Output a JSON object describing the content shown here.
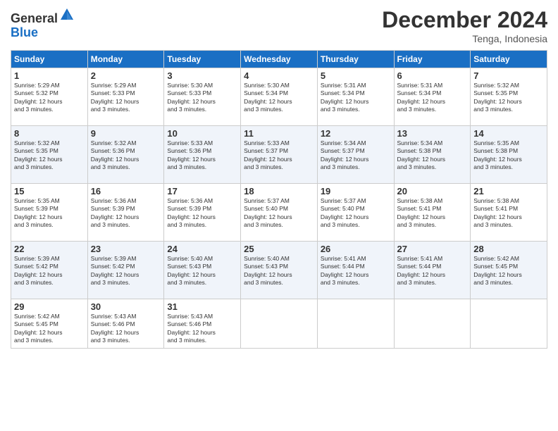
{
  "header": {
    "logo_general": "General",
    "logo_blue": "Blue",
    "month": "December 2024",
    "location": "Tenga, Indonesia"
  },
  "days_of_week": [
    "Sunday",
    "Monday",
    "Tuesday",
    "Wednesday",
    "Thursday",
    "Friday",
    "Saturday"
  ],
  "weeks": [
    [
      {
        "day": "1",
        "sunrise": "5:29 AM",
        "sunset": "5:32 PM",
        "daylight": "12 hours and 3 minutes."
      },
      {
        "day": "2",
        "sunrise": "5:29 AM",
        "sunset": "5:33 PM",
        "daylight": "12 hours and 3 minutes."
      },
      {
        "day": "3",
        "sunrise": "5:30 AM",
        "sunset": "5:33 PM",
        "daylight": "12 hours and 3 minutes."
      },
      {
        "day": "4",
        "sunrise": "5:30 AM",
        "sunset": "5:34 PM",
        "daylight": "12 hours and 3 minutes."
      },
      {
        "day": "5",
        "sunrise": "5:31 AM",
        "sunset": "5:34 PM",
        "daylight": "12 hours and 3 minutes."
      },
      {
        "day": "6",
        "sunrise": "5:31 AM",
        "sunset": "5:34 PM",
        "daylight": "12 hours and 3 minutes."
      },
      {
        "day": "7",
        "sunrise": "5:32 AM",
        "sunset": "5:35 PM",
        "daylight": "12 hours and 3 minutes."
      }
    ],
    [
      {
        "day": "8",
        "sunrise": "5:32 AM",
        "sunset": "5:35 PM",
        "daylight": "12 hours and 3 minutes."
      },
      {
        "day": "9",
        "sunrise": "5:32 AM",
        "sunset": "5:36 PM",
        "daylight": "12 hours and 3 minutes."
      },
      {
        "day": "10",
        "sunrise": "5:33 AM",
        "sunset": "5:36 PM",
        "daylight": "12 hours and 3 minutes."
      },
      {
        "day": "11",
        "sunrise": "5:33 AM",
        "sunset": "5:37 PM",
        "daylight": "12 hours and 3 minutes."
      },
      {
        "day": "12",
        "sunrise": "5:34 AM",
        "sunset": "5:37 PM",
        "daylight": "12 hours and 3 minutes."
      },
      {
        "day": "13",
        "sunrise": "5:34 AM",
        "sunset": "5:38 PM",
        "daylight": "12 hours and 3 minutes."
      },
      {
        "day": "14",
        "sunrise": "5:35 AM",
        "sunset": "5:38 PM",
        "daylight": "12 hours and 3 minutes."
      }
    ],
    [
      {
        "day": "15",
        "sunrise": "5:35 AM",
        "sunset": "5:39 PM",
        "daylight": "12 hours and 3 minutes."
      },
      {
        "day": "16",
        "sunrise": "5:36 AM",
        "sunset": "5:39 PM",
        "daylight": "12 hours and 3 minutes."
      },
      {
        "day": "17",
        "sunrise": "5:36 AM",
        "sunset": "5:39 PM",
        "daylight": "12 hours and 3 minutes."
      },
      {
        "day": "18",
        "sunrise": "5:37 AM",
        "sunset": "5:40 PM",
        "daylight": "12 hours and 3 minutes."
      },
      {
        "day": "19",
        "sunrise": "5:37 AM",
        "sunset": "5:40 PM",
        "daylight": "12 hours and 3 minutes."
      },
      {
        "day": "20",
        "sunrise": "5:38 AM",
        "sunset": "5:41 PM",
        "daylight": "12 hours and 3 minutes."
      },
      {
        "day": "21",
        "sunrise": "5:38 AM",
        "sunset": "5:41 PM",
        "daylight": "12 hours and 3 minutes."
      }
    ],
    [
      {
        "day": "22",
        "sunrise": "5:39 AM",
        "sunset": "5:42 PM",
        "daylight": "12 hours and 3 minutes."
      },
      {
        "day": "23",
        "sunrise": "5:39 AM",
        "sunset": "5:42 PM",
        "daylight": "12 hours and 3 minutes."
      },
      {
        "day": "24",
        "sunrise": "5:40 AM",
        "sunset": "5:43 PM",
        "daylight": "12 hours and 3 minutes."
      },
      {
        "day": "25",
        "sunrise": "5:40 AM",
        "sunset": "5:43 PM",
        "daylight": "12 hours and 3 minutes."
      },
      {
        "day": "26",
        "sunrise": "5:41 AM",
        "sunset": "5:44 PM",
        "daylight": "12 hours and 3 minutes."
      },
      {
        "day": "27",
        "sunrise": "5:41 AM",
        "sunset": "5:44 PM",
        "daylight": "12 hours and 3 minutes."
      },
      {
        "day": "28",
        "sunrise": "5:42 AM",
        "sunset": "5:45 PM",
        "daylight": "12 hours and 3 minutes."
      }
    ],
    [
      {
        "day": "29",
        "sunrise": "5:42 AM",
        "sunset": "5:45 PM",
        "daylight": "12 hours and 3 minutes."
      },
      {
        "day": "30",
        "sunrise": "5:43 AM",
        "sunset": "5:46 PM",
        "daylight": "12 hours and 3 minutes."
      },
      {
        "day": "31",
        "sunrise": "5:43 AM",
        "sunset": "5:46 PM",
        "daylight": "12 hours and 3 minutes."
      },
      null,
      null,
      null,
      null
    ]
  ],
  "labels": {
    "sunrise": "Sunrise:",
    "sunset": "Sunset:",
    "daylight": "Daylight:"
  }
}
